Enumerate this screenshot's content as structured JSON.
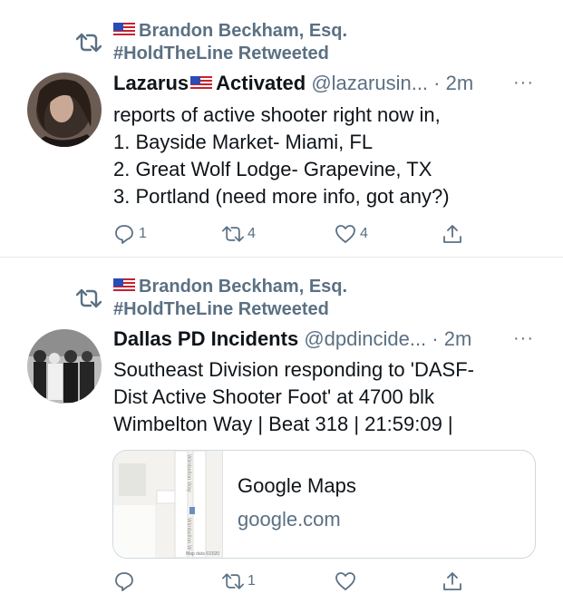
{
  "tweets": [
    {
      "retweeted_by": "Brandon Beckham, Esq.",
      "retweeted_by_line2": "#HoldTheLine Retweeted",
      "name_part1": "Lazarus",
      "name_part2": "Activated",
      "handle": "@lazarusin...",
      "time": "· 2m",
      "more": "···",
      "lines": [
        "reports of active shooter right now in,",
        "1. Bayside Market- Miami, FL",
        "2. Great Wolf Lodge- Grapevine, TX",
        "3. Portland (need more info, got any?)"
      ],
      "replies": "1",
      "retweets": "4",
      "likes": "4"
    },
    {
      "retweeted_by": "Brandon Beckham, Esq.",
      "retweeted_by_line2": "#HoldTheLine Retweeted",
      "name": "Dallas PD Incidents",
      "handle": "@dpdincide...",
      "time": "· 2m",
      "more": "···",
      "lines": [
        "Southeast Division responding to 'DASF-",
        "Dist Active Shooter Foot' at 4700 blk",
        "Wimbelton Way | Beat 318 | 21:59:09 |"
      ],
      "card": {
        "title": "Google Maps",
        "domain": "google.com",
        "map_street_1": "Wimbelton Way",
        "map_street_2": "Wimbelton W",
        "map_attribution": "Map data ©2020"
      },
      "replies": "",
      "retweets": "1",
      "likes": ""
    }
  ],
  "colors": {
    "secondary": "#5b7083",
    "text": "#0f1419",
    "border": "#cfd9de"
  },
  "icons": [
    "retweet-icon",
    "us-flag-icon",
    "reply-icon",
    "like-icon",
    "share-icon",
    "more-icon"
  ]
}
